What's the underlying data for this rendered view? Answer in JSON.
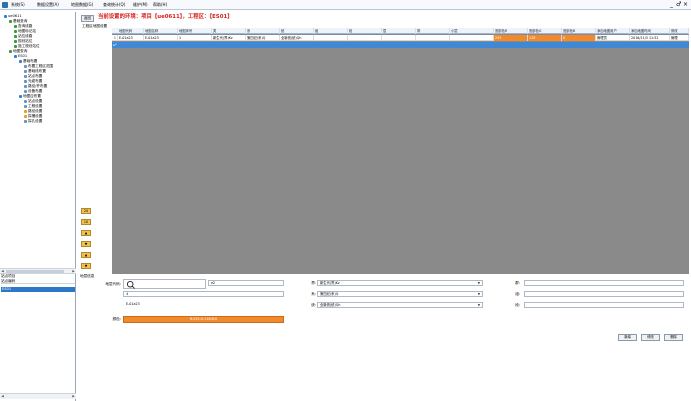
{
  "menubar": {
    "items": [
      "系统(S)",
      "数据设置(A)",
      "地图数据(G)",
      "查询统计(Q)",
      "维护(M)",
      "帮助(H)"
    ],
    "window_controls": [
      "_",
      "♂",
      "×"
    ]
  },
  "sidebar": {
    "tree": [
      {
        "label": "ue0611",
        "icon": "globe-icon",
        "color": "#2f7fd1"
      },
      {
        "label": "基础查询",
        "icon": "folder-icon",
        "color": "#3a9a3a"
      },
      {
        "label": "查询线路",
        "icon": "layer-icon",
        "color": "#3a9a3a"
      },
      {
        "label": "地图标记站",
        "icon": "layer-icon",
        "color": "#3a9a3a"
      },
      {
        "label": "站位线路",
        "icon": "layer-icon",
        "color": "#3a9a3a"
      },
      {
        "label": "规划站位",
        "icon": "layer-icon",
        "color": "#3a9a3a"
      },
      {
        "label": "施工规划站位",
        "icon": "layer-icon",
        "color": "#3a9a3a"
      },
      {
        "label": "地图查询",
        "icon": "folder-icon",
        "color": "#3a9a3a"
      },
      {
        "label": "ES01",
        "icon": "folder-icon",
        "color": "#2f7fd1"
      },
      {
        "label": "基础布置",
        "icon": "layer-icon",
        "color": "#2f7fd1"
      },
      {
        "label": "布置工程区范围",
        "icon": "doc-icon",
        "color": "#6a8fc2"
      },
      {
        "label": "基础线布置",
        "icon": "doc-icon",
        "color": "#6a8fc2"
      },
      {
        "label": "站点布置",
        "icon": "doc-icon",
        "color": "#6a8fc2"
      },
      {
        "label": "光缆布置",
        "icon": "doc-icon",
        "color": "#6a8fc2"
      },
      {
        "label": "路径/杆布置",
        "icon": "doc-icon",
        "color": "#6a8fc2"
      },
      {
        "label": "设备布置",
        "icon": "doc-icon",
        "color": "#6a8fc2"
      },
      {
        "label": "地图应布置",
        "icon": "layer-icon",
        "color": "#2f7fd1"
      },
      {
        "label": "站点设置",
        "icon": "doc-icon",
        "color": "#6a8fc2"
      },
      {
        "label": "工程设置",
        "icon": "doc-icon",
        "color": "#6a8fc2"
      },
      {
        "label": "路径设置",
        "icon": "doc-icon",
        "color": "#e0a020"
      },
      {
        "label": "探槽设置",
        "icon": "doc-icon",
        "color": "#e0a020"
      },
      {
        "label": "探孔设置",
        "icon": "doc-icon",
        "color": "#6a8fc2"
      }
    ],
    "box_title": "站点项目",
    "box_header": "站点编码",
    "box_selected": "ES01"
  },
  "main": {
    "return_button": "返回",
    "current_env": "当前设置的环境：项目【ue0611】，工程区：【ES01】",
    "section_caption": "工程区地图设置",
    "grid": {
      "columns": [
        "地图代码",
        "地图名称",
        "地图序号",
        "类",
        "系",
        "统",
        "组",
        "段",
        "层",
        "带",
        "小层",
        "底部色R",
        "底部色G",
        "底部色B",
        "添加地图用户",
        "添加地图时间",
        "修改"
      ],
      "rows": [
        {
          "num": "1",
          "cells": [
            "E-01a23",
            "E-01a23",
            "1",
            "新生代(界)Kz",
            "第四纪(系)Q",
            "全新统(统)Qh",
            "",
            "",
            "",
            "",
            "",
            "255",
            "128",
            "0",
            "管理员",
            "2016/11/3 11:52",
            "管理"
          ]
        }
      ],
      "new_row_marker": "▸*"
    },
    "side_buttons": [
      "20",
      "10",
      "▲",
      "▼",
      "▲",
      "▼"
    ],
    "form": {
      "title": "地层信息",
      "code_label": "地层代码:",
      "code_value": "",
      "name_value": "e2",
      "order_value": "4",
      "extra_value": "E-01a23",
      "color_label": "颜色:",
      "color_text": "R:255;G:128;B:0",
      "field1_label": "界:",
      "field1_value": "新生代(界)Kz",
      "field2_label": "系:",
      "field2_value": "第四纪(系)Q",
      "field3_label": "统:",
      "field3_value": "全新统(统)Qh",
      "field4_label": "群:",
      "field5_label": "组:",
      "field6_label": "段:",
      "buttons": [
        "新增",
        "修改",
        "删除"
      ],
      "color": "#f08a2d"
    }
  }
}
